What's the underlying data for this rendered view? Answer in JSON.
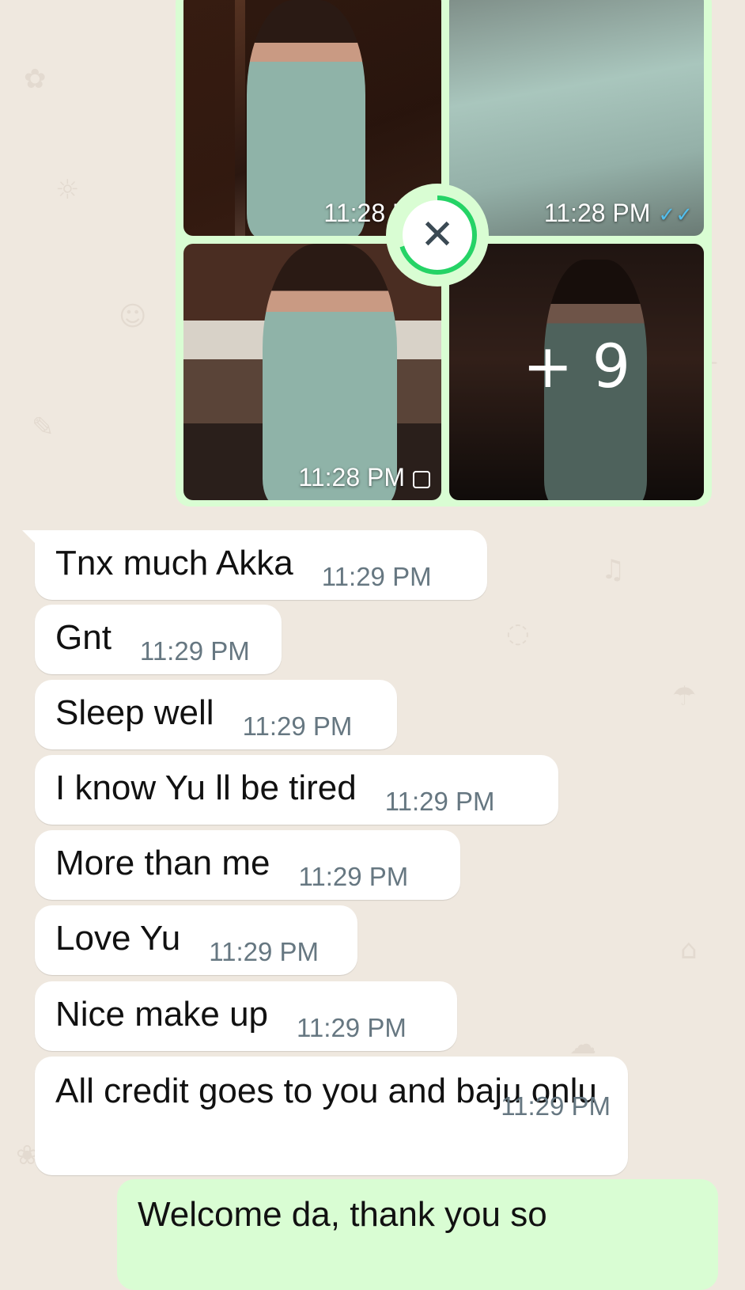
{
  "media": {
    "tiles": [
      {
        "time": "11:28 PM"
      },
      {
        "time": "11:28 PM"
      },
      {
        "time": "11:28 PM"
      },
      {
        "more_count": "+ 9"
      }
    ],
    "colors": {
      "bubble": "#d9fdd3",
      "progress": "#25d366",
      "read_ticks": "#53bdeb"
    },
    "icons": {
      "read": "double-check-icon",
      "pending": "clock-icon",
      "cancel": "close-icon"
    }
  },
  "messages": [
    {
      "text": "Tnx much Akka",
      "time": "11:29 PM"
    },
    {
      "text": "Gnt",
      "time": "11:29 PM"
    },
    {
      "text": "Sleep well",
      "time": "11:29 PM"
    },
    {
      "text": "I know Yu ll be tired",
      "time": "11:29 PM"
    },
    {
      "text": "More than me",
      "time": "11:29 PM"
    },
    {
      "text": "Love Yu",
      "time": "11:29 PM"
    },
    {
      "text": "Nice make up",
      "time": "11:29 PM"
    },
    {
      "text": "All credit goes to you and baju onlu",
      "time": "11:29 PM"
    }
  ],
  "outgoing": {
    "text": "Welcome da, thank you so"
  }
}
